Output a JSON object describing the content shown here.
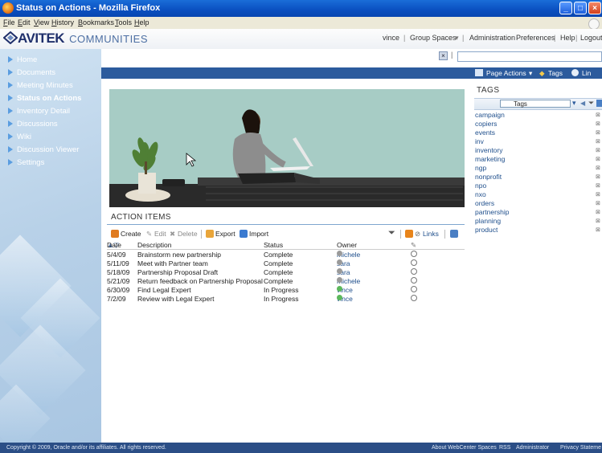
{
  "window": {
    "title": "Status on Actions - Mozilla Firefox"
  },
  "menubar": [
    "File",
    "Edit",
    "View",
    "History",
    "Bookmarks",
    "Tools",
    "Help"
  ],
  "header": {
    "brand": "AVITEK",
    "communities": "COMMUNITIES",
    "user": "vince",
    "group_spaces": "Group Spaces",
    "administration": "Administration",
    "preferences": "Preferences",
    "help": "Help",
    "logout": "Logout"
  },
  "nav": {
    "items": [
      {
        "label": "Home"
      },
      {
        "label": "Documents"
      },
      {
        "label": "Meeting Minutes"
      },
      {
        "label": "Status on Actions",
        "active": true
      },
      {
        "label": "Inventory Detail"
      },
      {
        "label": "Discussions"
      },
      {
        "label": "Wiki"
      },
      {
        "label": "Discussion Viewer"
      },
      {
        "label": "Settings"
      }
    ]
  },
  "page_actions": {
    "page_actions": "Page Actions",
    "tags": "Tags",
    "links": "Lin"
  },
  "action_items": {
    "title": "ACTION ITEMS",
    "toolbar": {
      "create": "Create",
      "edit": "Edit",
      "delete": "Delete",
      "export": "Export",
      "import": "Import",
      "links": "Links"
    },
    "columns": {
      "date": "Date",
      "description": "Description",
      "status": "Status",
      "owner": "Owner"
    },
    "rows": [
      {
        "date": "5/4/09",
        "description": "Brainstorm new partnership",
        "status": "Complete",
        "owner": "michele"
      },
      {
        "date": "5/11/09",
        "description": "Meet with Partner team",
        "status": "Complete",
        "owner": "sara"
      },
      {
        "date": "5/18/09",
        "description": "Partnership Proposal Draft",
        "status": "Complete",
        "owner": "sara"
      },
      {
        "date": "5/21/09",
        "description": "Return feedback on Partnership Proposal",
        "status": "Complete",
        "owner": "michele"
      },
      {
        "date": "6/30/09",
        "description": "Find Legal Expert",
        "status": "In Progress",
        "owner": "vince"
      },
      {
        "date": "7/2/09",
        "description": "Review with Legal Expert",
        "status": "In Progress",
        "owner": "vince"
      }
    ]
  },
  "tags": {
    "title": "TAGS",
    "select_value": "Tags",
    "items": [
      "campaign",
      "copiers",
      "events",
      "inv",
      "inventory",
      "marketing",
      "ngp",
      "nonprofit",
      "npo",
      "nxo",
      "orders",
      "partnership",
      "planning",
      "product"
    ]
  },
  "footer": {
    "copyright": "Copyright © 2009, Oracle and/or its affiliates. All rights reserved.",
    "about": "About WebCenter Spaces",
    "rss": "RSS",
    "administrator": "Administrator",
    "privacy": "Privacy Stateme"
  },
  "colors": {
    "accent_bar": "#2c5b9d",
    "footer": "#2b4e86",
    "link": "#1f4f8c"
  }
}
